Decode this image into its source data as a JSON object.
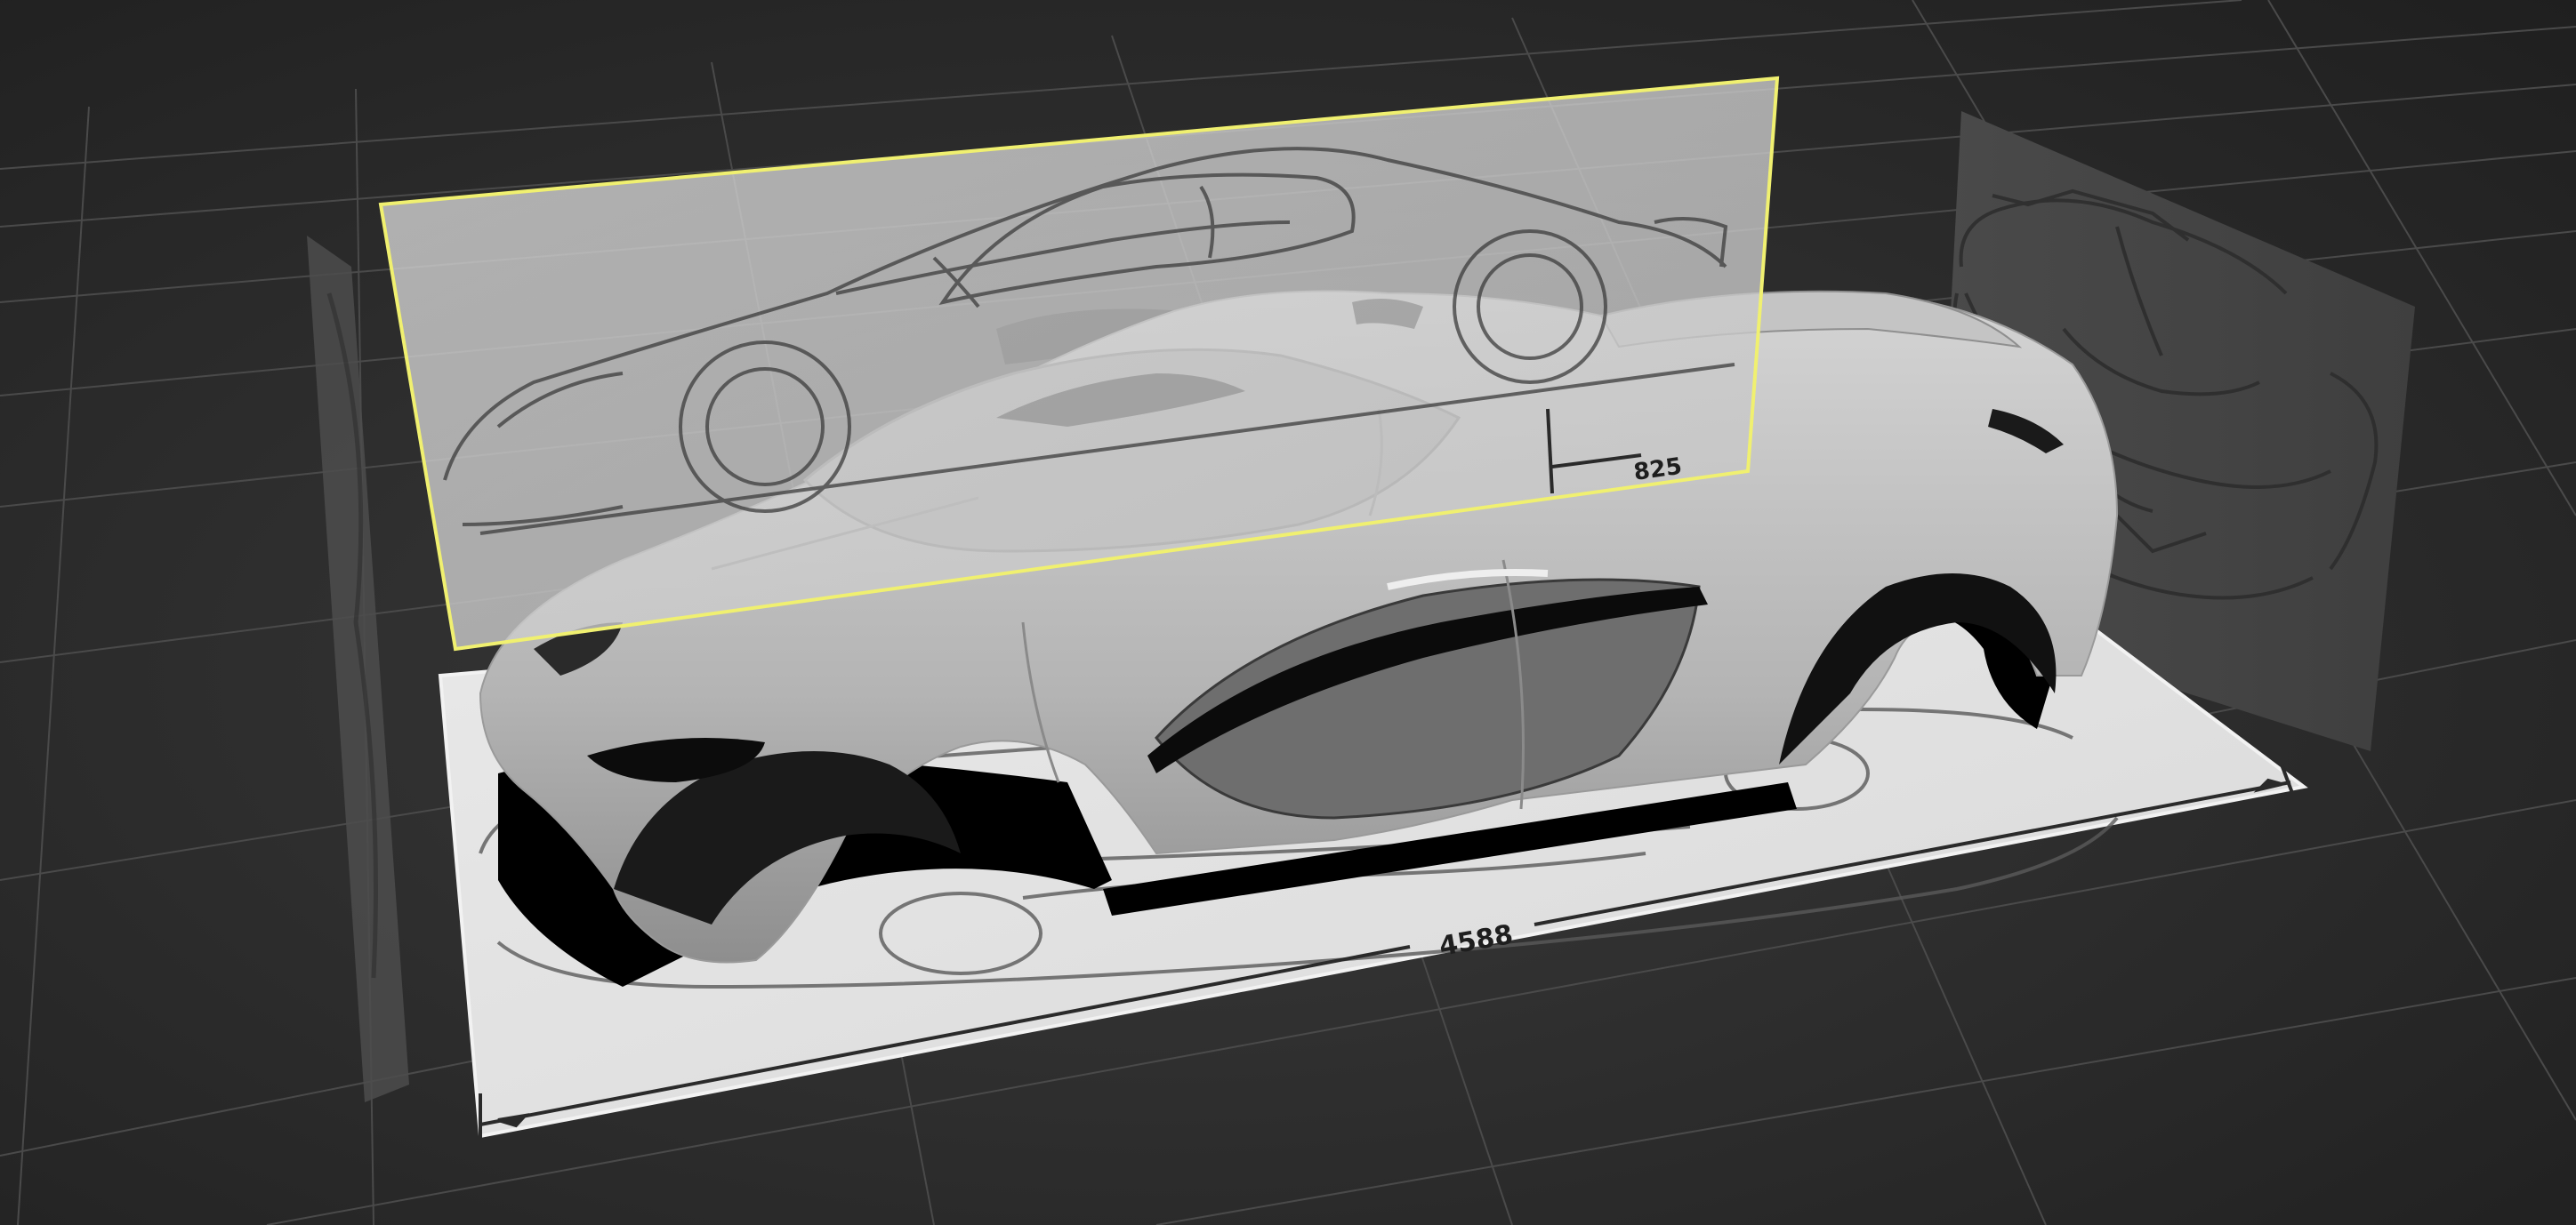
{
  "viewport": {
    "background_color": "#2b2b2b",
    "grid_color": "#4a4a4a",
    "selection_color": "#f0f070"
  },
  "blueprints": {
    "side_view": {
      "dimension_label": "825",
      "selected": true
    },
    "top_view": {
      "dimension_label": "4588"
    },
    "front_view": {},
    "rear_view": {}
  },
  "model": {
    "material_color": "#b9b9b9"
  }
}
